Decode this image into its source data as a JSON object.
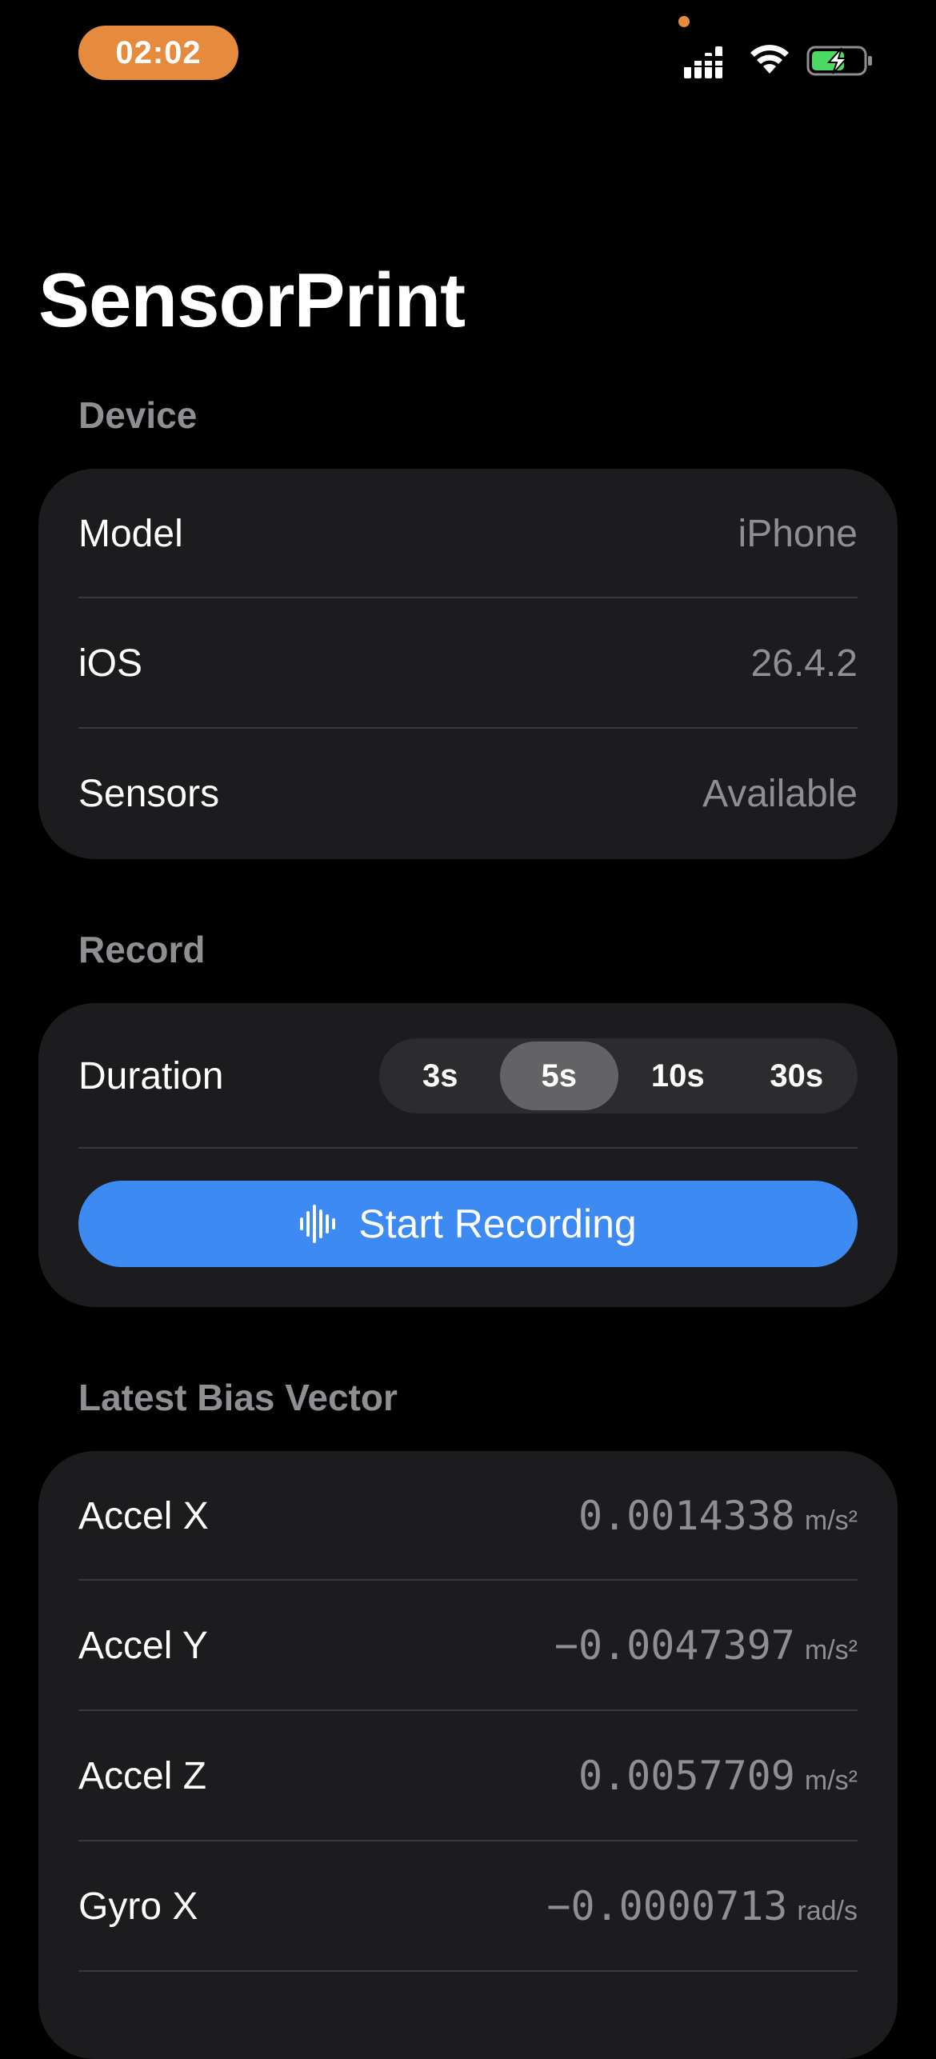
{
  "status_bar": {
    "time": "02:02"
  },
  "title": "SensorPrint",
  "device": {
    "header": "Device",
    "rows": [
      {
        "label": "Model",
        "value": "iPhone"
      },
      {
        "label": "iOS",
        "value": "26.4.2"
      },
      {
        "label": "Sensors",
        "value": "Available"
      }
    ]
  },
  "record": {
    "header": "Record",
    "duration_label": "Duration",
    "segments": [
      "3s",
      "5s",
      "10s",
      "30s"
    ],
    "selected_segment": "5s",
    "button_label": "Start Recording",
    "button_icon": "waveform-icon"
  },
  "bias": {
    "header": "Latest Bias Vector",
    "rows": [
      {
        "label": "Accel X",
        "value": "0.0014338",
        "unit": "m/s²"
      },
      {
        "label": "Accel Y",
        "value": "−0.0047397",
        "unit": "m/s²"
      },
      {
        "label": "Accel Z",
        "value": "0.0057709",
        "unit": "m/s²"
      },
      {
        "label": "Gyro X",
        "value": "−0.0000713",
        "unit": "rad/s"
      }
    ]
  },
  "colors": {
    "accent": "#3D8AF3",
    "time_pill": "#E68A3E",
    "card": "#1C1C1E",
    "secondary_text": "#8E8E93",
    "battery": "#4CD964"
  }
}
